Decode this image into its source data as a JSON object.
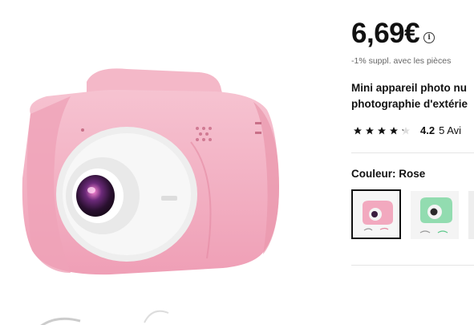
{
  "product": {
    "price": "6,69€",
    "price_info_icon": "info-icon",
    "price_note": "-1% suppl. avec les pièces",
    "title_line1": "Mini appareil photo nu",
    "title_line2": "photographie d'extérie",
    "rating": 4.2,
    "rating_value": "4.2",
    "rating_count": "5 Avi",
    "color_label": "Couleur:",
    "color_value": "Rose",
    "variants": [
      {
        "name": "pink-camera",
        "color": "#f2a9bf",
        "selected": true
      },
      {
        "name": "green-camera",
        "color": "#92dcb0",
        "selected": false
      },
      {
        "name": "third-camera",
        "color": "#eeeeee",
        "selected": false
      }
    ]
  },
  "colors": {
    "camera_pink": "#f3b5c6",
    "camera_pink_dark": "#e79bb0",
    "lens_ring": "#f2f2f2",
    "star": "#111111"
  }
}
